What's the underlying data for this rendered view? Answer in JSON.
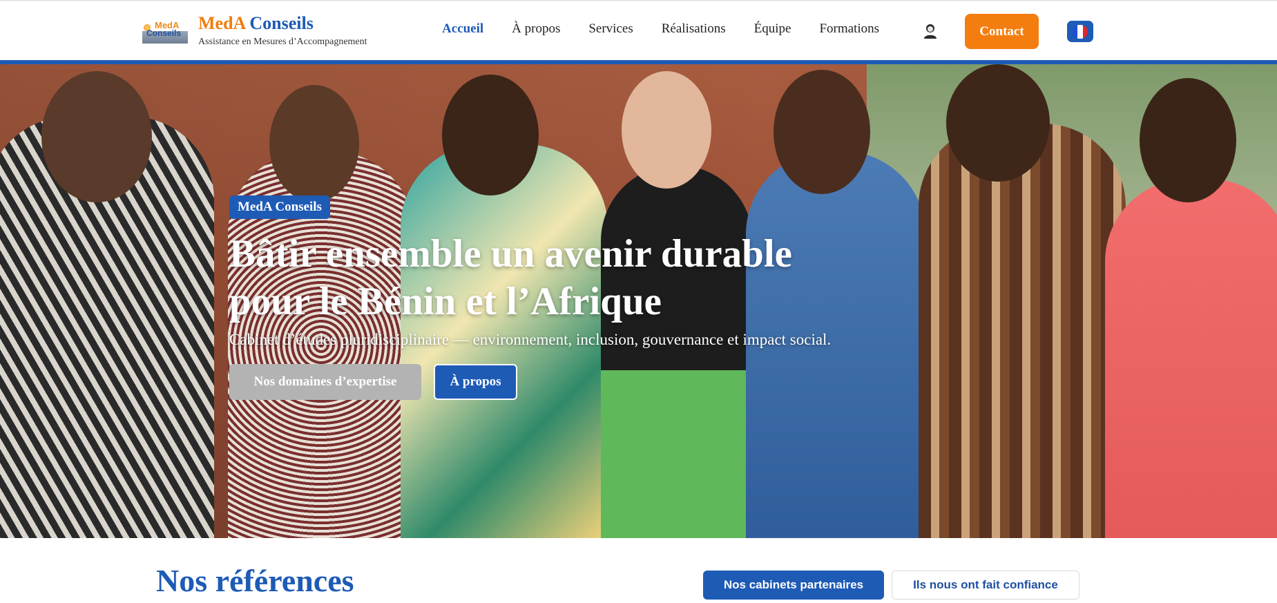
{
  "header": {
    "logo": {
      "word1": "MedA",
      "word2": "Conseils"
    },
    "brand_title_part1": "MedA",
    "brand_title_part2": "Conseils",
    "brand_subtitle": "Assistance en Mesures d’Accompagnement",
    "nav": [
      {
        "label": "Accueil",
        "active": true
      },
      {
        "label": "À propos"
      },
      {
        "label": "Services"
      },
      {
        "label": "Réalisations"
      },
      {
        "label": "Équipe"
      },
      {
        "label": "Formations"
      }
    ],
    "user_icon": "user-icon",
    "contact_label": "Contact",
    "language_flag": "france-flag-icon"
  },
  "hero": {
    "badge": "MedA Conseils",
    "title_line1": "Bâtir ensemble un avenir durable",
    "title_line2": "pour le Bénin et l’Afrique",
    "subtitle": "Cabinet d’études pluridisciplinaire — environnement, inclusion, gouvernance et impact social.",
    "button_primary": "Nos domaines d’expertise",
    "button_secondary": "À propos"
  },
  "references": {
    "title": "Nos références",
    "tabs": [
      {
        "label": "Nos cabinets partenaires",
        "active": true
      },
      {
        "label": "Ils nous ont fait confiance",
        "active": false
      }
    ]
  },
  "colors": {
    "primary_blue": "#1e5bb5",
    "accent_orange": "#f47d0f",
    "muted_button": "#b3b3b3"
  }
}
